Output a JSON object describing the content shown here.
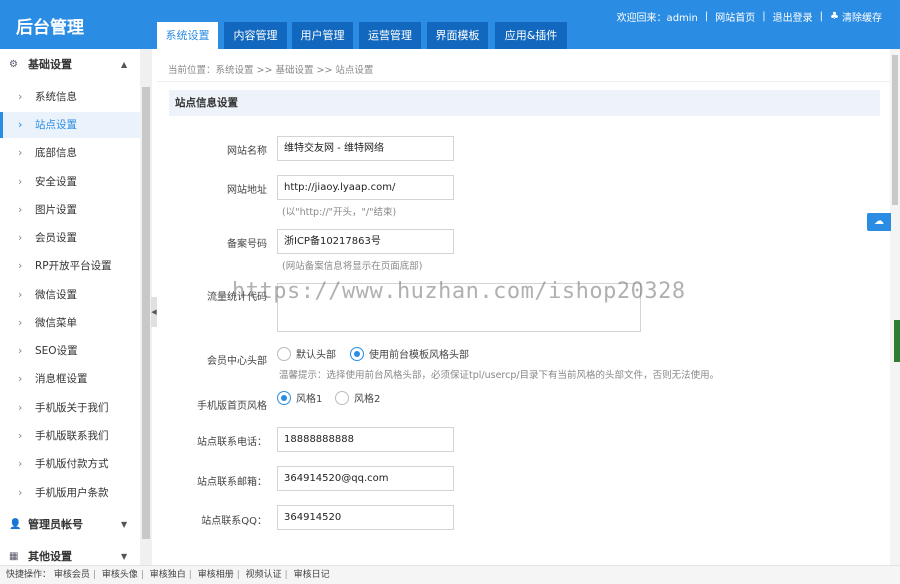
{
  "header": {
    "logo": "后台管理",
    "tabs": [
      "系统设置",
      "内容管理",
      "用户管理",
      "运营管理",
      "界面模板",
      "应用&插件"
    ],
    "links": {
      "welcome": "欢迎回来：admin",
      "home": "网站首页",
      "logout": "退出登录",
      "clear_cache": "清除缓存"
    }
  },
  "sidebar": {
    "groups": [
      {
        "label": "基础设置",
        "icon": "gear-icon"
      },
      {
        "label": "管理员帐号",
        "icon": "user-icon"
      },
      {
        "label": "其他设置",
        "icon": "grid-icon"
      }
    ],
    "items": [
      "系统信息",
      "站点设置",
      "底部信息",
      "安全设置",
      "图片设置",
      "会员设置",
      "RP开放平台设置",
      "微信设置",
      "微信菜单",
      "SEO设置",
      "消息框设置",
      "手机版关于我们",
      "手机版联系我们",
      "手机版付款方式",
      "手机版用户条款"
    ]
  },
  "main": {
    "breadcrumb": "当前位置：系统设置 >> 基础设置 >> 站点设置",
    "section_title": "站点信息设置",
    "site_name_label": "网站名称",
    "site_name_value": "维特交友网 - 维特网络",
    "site_url_label": "网站地址",
    "site_url_value": "http://jiaoy.lyaap.com/",
    "site_url_hint": "(以\"http://\"开头，\"/\"结束)",
    "icp_label": "备案号码",
    "icp_value": "浙ICP备10217863号",
    "icp_hint": "(网站备案信息将显示在页面底部)",
    "stats_label": "流量统计代码",
    "member_head_label": "会员中心头部",
    "member_head_options": [
      "默认头部",
      "使用前台模板风格头部"
    ],
    "member_head_selected": 1,
    "member_head_hint": "温馨提示：选择使用前台风格头部，必须保证tpl/usercp/目录下有当前风格的头部文件，否则无法使用。",
    "mobile_style_label": "手机版首页风格",
    "mobile_style_options": [
      "风格1",
      "风格2"
    ],
    "mobile_style_selected": 0,
    "phone_label": "站点联系电话：",
    "phone_value": "18888888888",
    "email_label": "站点联系邮箱：",
    "email_value": "364914520@qq.com",
    "qq_label": "站点联系QQ：",
    "qq_value": "364914520"
  },
  "watermark": "https://www.huzhan.com/ishop20328",
  "footer": {
    "label": "快捷操作：",
    "links": [
      "审核会员",
      "审核头像",
      "审核独白",
      "审核相册",
      "视频认证",
      "审核日记"
    ]
  },
  "colors": {
    "accent": "#2a8ce3",
    "tab_bg": "#1268bf",
    "section_bg": "#eef3fa"
  }
}
